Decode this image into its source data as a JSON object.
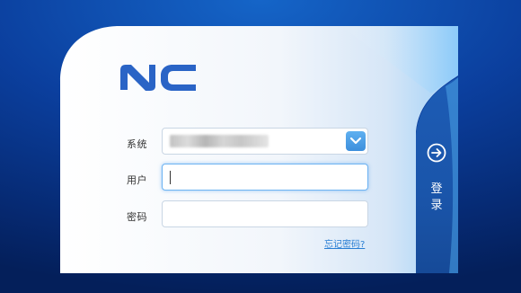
{
  "brand": {
    "logo_text": "NC",
    "logo_color": "#2a64c6"
  },
  "form": {
    "system_label": "系统",
    "user_label": "用户",
    "password_label": "密码",
    "system_value": "",
    "user_value": "",
    "password_value": "",
    "forgot_label": "忘记密码?"
  },
  "login": {
    "label": "登录",
    "icon": "arrow-right-circle-icon"
  },
  "colors": {
    "background": "#0b3f9e",
    "accent": "#3d8fdc",
    "link": "#2a7fd4"
  }
}
